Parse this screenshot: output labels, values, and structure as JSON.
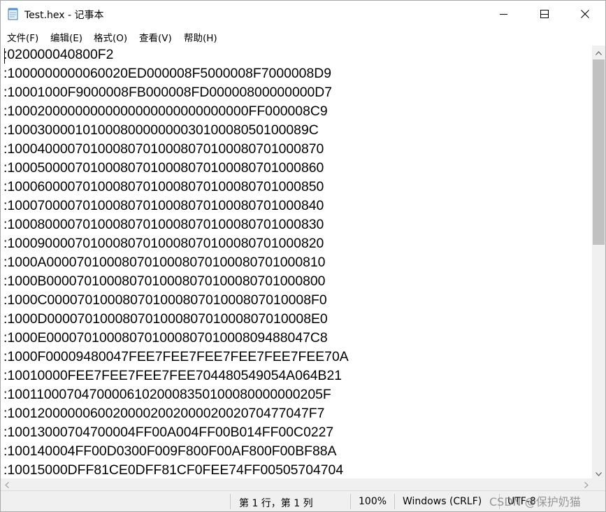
{
  "window": {
    "title": "Test.hex - 记事本"
  },
  "icons": {
    "app": "notepad-icon",
    "minimize": "minimize-icon",
    "maximize": "maximize-icon",
    "close": "close-icon"
  },
  "menu": {
    "items": [
      {
        "label": "文件(F)"
      },
      {
        "label": "编辑(E)"
      },
      {
        "label": "格式(O)"
      },
      {
        "label": "查看(V)"
      },
      {
        "label": "帮助(H)"
      }
    ]
  },
  "editor": {
    "lines": [
      ":020000040800F2",
      ":1000000000060020ED000008F5000008F7000008D9",
      ":10001000F9000008FB000008FD00000800000000D7",
      ":10002000000000000000000000000000FF000008C9",
      ":100030000101000800000000301000805010008​9C",
      ":10004000070100080701000807010008070100087​0",
      ":10005000070100080701000807010008070100086​0",
      ":10006000070100080701000807010008070100085​0",
      ":10007000070100080701000807010008070100084​0",
      ":10008000070100080701000807010008070100083​0",
      ":10009000070100080701000807010008070100082​0",
      ":1000A000070100080701000807010008070100081​0",
      ":1000B000070100080701000807010008070100080​0",
      ":1000C0000701000807010008070100080701000​8F0",
      ":1000D0000701000807010008070100080701000​8E0",
      ":1000E000070100080701000807010008094880​47C8",
      ":1000F00009480047FEE7FEE7FEE7FEE7FEE7FEE70A",
      ":10010000FEE7FEE7FEE7FEE704480549054A064B21",
      ":100110007047000061020008350100080000000205F",
      ":1001200000060020000200200002002070477047F7",
      ":10013000704700004FF00A004FF00B014FF00C0227",
      ":100140004FF00D0300F009F800F00AF800F00BF88A",
      ":10015000DFF81CE0DFF81CF0FEE74FF00505704704"
    ]
  },
  "status": {
    "position": "第 1 行，第 1 列",
    "zoom": "100%",
    "line_ending": "Windows (CRLF)",
    "encoding": "UTF-8"
  },
  "watermark": {
    "text": "CSDN @保护奶猫"
  }
}
